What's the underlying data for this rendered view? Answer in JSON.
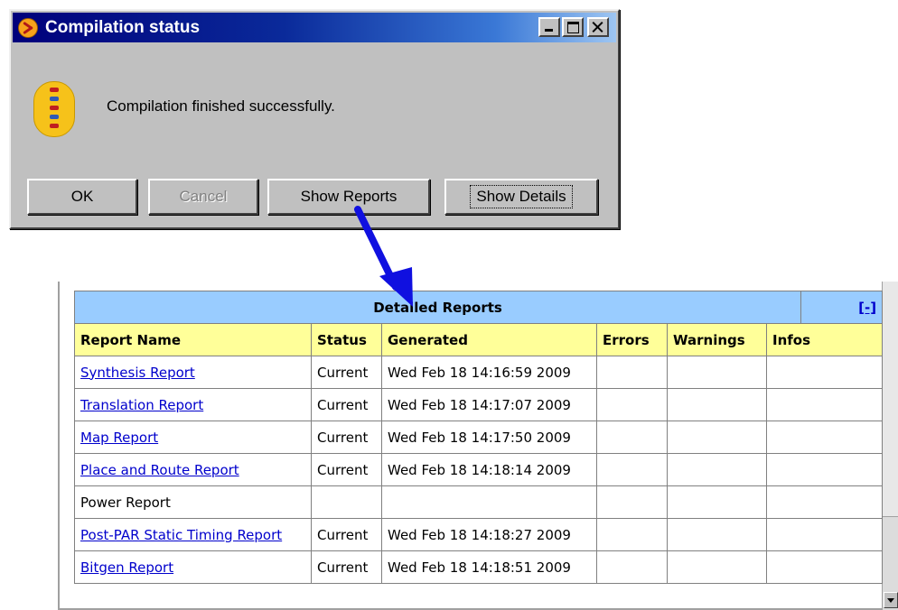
{
  "dialog": {
    "title": "Compilation status",
    "message": "Compilation finished successfully.",
    "buttons": {
      "ok": "OK",
      "cancel": "Cancel",
      "show_reports": "Show Reports",
      "show_details": "Show Details"
    }
  },
  "reports": {
    "title": "Detailed Reports",
    "toggle": "[-]",
    "columns": [
      "Report Name",
      "Status",
      "Generated",
      "Errors",
      "Warnings",
      "Infos"
    ],
    "rows": [
      {
        "name": "Synthesis Report",
        "link": true,
        "status": "Current",
        "generated": "Wed Feb 18 14:16:59 2009",
        "errors": "",
        "warnings": "",
        "infos": ""
      },
      {
        "name": "Translation Report",
        "link": true,
        "status": "Current",
        "generated": "Wed Feb 18 14:17:07 2009",
        "errors": "",
        "warnings": "",
        "infos": ""
      },
      {
        "name": "Map Report",
        "link": true,
        "status": "Current",
        "generated": "Wed Feb 18 14:17:50 2009",
        "errors": "",
        "warnings": "",
        "infos": ""
      },
      {
        "name": "Place and Route Report",
        "link": true,
        "status": "Current",
        "generated": "Wed Feb 18 14:18:14 2009",
        "errors": "",
        "warnings": "",
        "infos": ""
      },
      {
        "name": "Power Report",
        "link": false,
        "status": "",
        "generated": "",
        "errors": "",
        "warnings": "",
        "infos": ""
      },
      {
        "name": "Post-PAR Static Timing Report",
        "link": true,
        "status": "Current",
        "generated": "Wed Feb 18 14:18:27 2009",
        "errors": "",
        "warnings": "",
        "infos": ""
      },
      {
        "name": "Bitgen Report",
        "link": true,
        "status": "Current",
        "generated": "Wed Feb 18 14:18:51 2009",
        "errors": "",
        "warnings": "",
        "infos": ""
      }
    ]
  },
  "colors": {
    "title_bar": "#00007b",
    "table_title_bg": "#99ccff",
    "table_header_bg": "#ffff99",
    "link": "#0000cc",
    "arrow": "#1010e0"
  },
  "icons": {
    "app": "compilation-app-icon",
    "message": "success-info-icon",
    "arrow": "pointer-arrow"
  }
}
